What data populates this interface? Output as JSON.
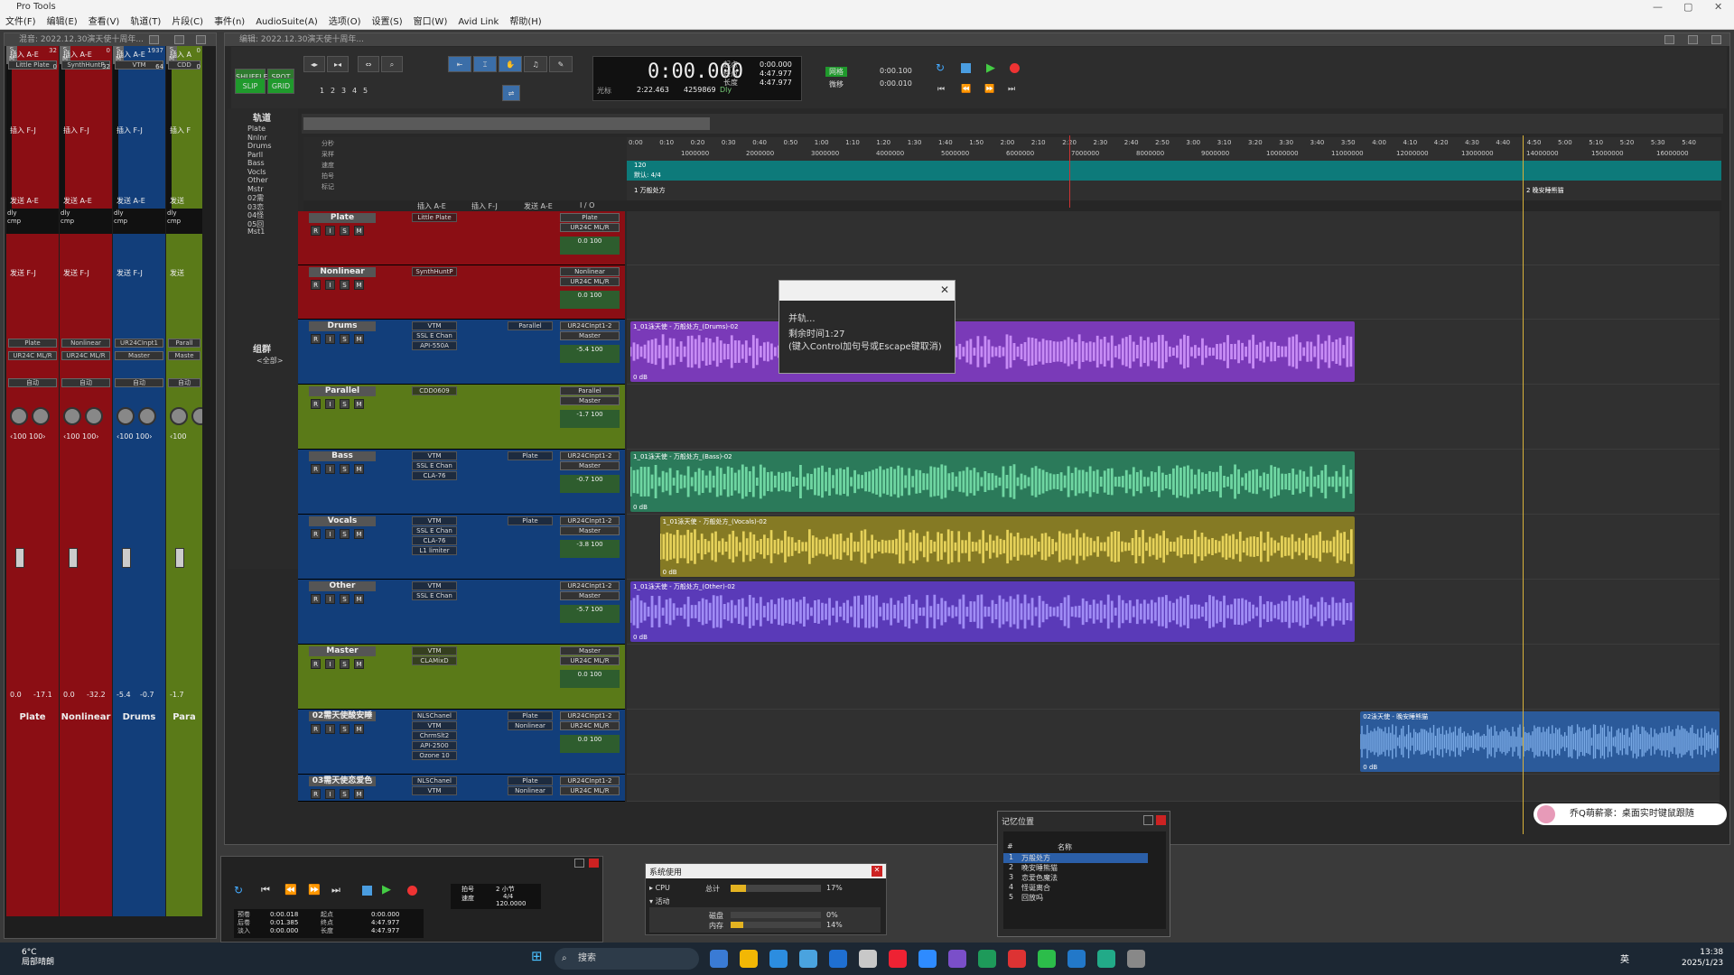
{
  "app": {
    "title": "Pro Tools"
  },
  "menu": [
    "文件(F)",
    "编辑(E)",
    "查看(V)",
    "轨道(T)",
    "片段(C)",
    "事件(n)",
    "AudioSuite(A)",
    "选项(O)",
    "设置(S)",
    "窗口(W)",
    "Avid Link",
    "帮助(H)"
  ],
  "mix_window": {
    "title": "混音: 2022.12.30演天使十周年...",
    "strips": [
      {
        "name": "Plate",
        "insert_ae": "插入 A-E",
        "insert_fj": "插入 F-J",
        "send_ae": "发送 A-E",
        "send_fj": "发送 F-J",
        "plugin": "Little Plate",
        "io_in": "Plate",
        "io_out": "UR24C ML/R",
        "auto": "自动",
        "pan": "‹100  100›",
        "vol": "0.0",
        "peak": "-17.1",
        "dly": "32",
        "cmp": "0",
        "color": "#8b0e14"
      },
      {
        "name": "Nonlinear",
        "insert_ae": "插入 A-E",
        "insert_fj": "插入 F-J",
        "send_ae": "发送 A-E",
        "send_fj": "发送 F-J",
        "plugin": "SynthHuntP",
        "io_in": "Nonlinear",
        "io_out": "UR24C ML/R",
        "auto": "自动",
        "pan": "‹100  100›",
        "vol": "0.0",
        "peak": "-32.2",
        "dly": "0",
        "cmp": "32",
        "color": "#8b0e14"
      },
      {
        "name": "Drums",
        "insert_ae": "插入 A-E",
        "insert_fj": "插入 F-J",
        "send_ae": "发送 A-E",
        "send_fj": "发送 F-J",
        "plugin": "VTM",
        "io_in": "UR24CInpt1",
        "io_out": "Master",
        "auto": "自动",
        "pan": "‹100  100›",
        "vol": "-5.4",
        "peak": "-0.7",
        "dly": "1937",
        "cmp": "64",
        "color": "#123e7a"
      },
      {
        "name": "Para",
        "insert_ae": "插入 A",
        "insert_fj": "插入 F",
        "send_ae": "发送",
        "send_fj": "发送",
        "plugin": "CDD",
        "io_in": "Parall",
        "io_out": "Maste",
        "auto": "自动",
        "pan": "‹100",
        "vol": "-1.7",
        "peak": "",
        "dly": "0",
        "cmp": "0",
        "color": "#5a7a18"
      }
    ]
  },
  "edit_window": {
    "title": "编辑: 2022.12.30演天使十周年...",
    "modes": [
      "SHUFFLE",
      "SPOT",
      "SLIP",
      "GRID"
    ],
    "nums": [
      "1",
      "2",
      "3",
      "4",
      "5"
    ],
    "counter": {
      "main": "0:00.000",
      "sub": "2:22.463",
      "samples": "4259869",
      "start": "0:00.000",
      "end": "4:47.977",
      "len": "4:47.977",
      "lbl_start": "起点",
      "lbl_end": "终点",
      "lbl_len": "长度",
      "cursor_lbl": "光标",
      "nudge": "0:00.100",
      "grid": "0:00.010",
      "nudge_lbl": "网格",
      "grid_lbl": "微移",
      "dly": "Dly"
    },
    "tracks_header": "轨道",
    "groups_header": "组群",
    "groups_all": "<全部>",
    "tracklist": [
      "Plate",
      "Nnlnr",
      "Drums",
      "Parll",
      "Bass",
      "Vocls",
      "Other",
      "Mstr",
      "02需",
      "03恋",
      "04怪",
      "05回",
      "Mst1"
    ],
    "ruler_times": [
      "0:00",
      "0:10",
      "0:20",
      "0:30",
      "0:40",
      "0:50",
      "1:00",
      "1:10",
      "1:20",
      "1:30",
      "1:40",
      "1:50",
      "2:00",
      "2:10",
      "2:20",
      "2:30",
      "2:40",
      "2:50",
      "3:00",
      "3:10",
      "3:20",
      "3:30",
      "3:40",
      "3:50",
      "4:00",
      "4:10",
      "4:20",
      "4:30",
      "4:40",
      "4:50",
      "5:00",
      "5:10",
      "5:20",
      "5:30",
      "5:40"
    ],
    "ruler_samples": [
      "1000000",
      "2000000",
      "3000000",
      "4000000",
      "5000000",
      "6000000",
      "7000000",
      "8000000",
      "9000000",
      "10000000",
      "11000000",
      "12000000",
      "13000000",
      "14000000",
      "15000000",
      "16000000"
    ],
    "ruler_rows": [
      "分秒",
      "采样",
      "速度",
      "拍号",
      "标记"
    ],
    "tempo": "120",
    "meter": "默认: 4/4",
    "markers": [
      "1 万般处方",
      "2 晚安睡熊猫"
    ],
    "col_headers": [
      "插入 A-E",
      "插入 F-J",
      "发送 A-E",
      "I / O"
    ],
    "tracks": [
      {
        "name": "Plate",
        "color": "#8b0e14",
        "h": 60,
        "ins": [
          "Little Plate"
        ],
        "io1": "Plate",
        "io2": "UR24C ML/R",
        "v1": "0.0",
        "v2": "100",
        "clip": null
      },
      {
        "name": "Nonlinear",
        "color": "#8b0e14",
        "h": 60,
        "ins": [
          "SynthHuntP"
        ],
        "io1": "Nonlinear",
        "io2": "UR24C ML/R",
        "v1": "0.0",
        "v2": "100",
        "clip": null
      },
      {
        "name": "Drums",
        "color": "#123e7a",
        "h": 72,
        "ins": [
          "VTM",
          "SSL E Chan",
          "API-550A"
        ],
        "send": "Parallel",
        "io1": "UR24CInpt1-2",
        "io2": "Master",
        "v1": "-5.4",
        "v2": "100",
        "clip": {
          "label": "1_01泳天使 - 万般处方_(Drums)-02",
          "db": "0 dB",
          "fill": "#7a3ab8",
          "wave": "#c78cf5",
          "x0": 0.0,
          "x1": 0.666
        }
      },
      {
        "name": "Parallel",
        "color": "#5a7a18",
        "h": 72,
        "ins": [
          "CDD0609"
        ],
        "send": "",
        "io1": "Parallel",
        "io2": "Master",
        "v1": "-1.7",
        "v2": "100",
        "clip": null
      },
      {
        "name": "Bass",
        "color": "#123e7a",
        "h": 72,
        "ins": [
          "VTM",
          "SSL E Chan",
          "CLA-76"
        ],
        "send": "Plate",
        "io1": "UR24CInpt1-2",
        "io2": "Master",
        "v1": "-0.7",
        "v2": "100",
        "clip": {
          "label": "1_01泳天使 - 万般处方_(Bass)-02",
          "db": "0 dB",
          "fill": "#2b7a5a",
          "wave": "#6fd6a2",
          "x0": 0.0,
          "x1": 0.666
        }
      },
      {
        "name": "Vocals",
        "color": "#123e7a",
        "h": 72,
        "ins": [
          "VTM",
          "SSL E Chan",
          "CLA-76",
          "L1 limiter"
        ],
        "send": "Plate",
        "io1": "UR24CInpt1-2",
        "io2": "Master",
        "v1": "-3.8",
        "v2": "100",
        "clip": {
          "label": "1_01泳天使 - 万般处方_(Vocals)-02",
          "db": "0 dB",
          "fill": "#857a24",
          "wave": "#e6d25a",
          "x0": 0.027,
          "x1": 0.666
        }
      },
      {
        "name": "Other",
        "color": "#123e7a",
        "h": 72,
        "ins": [
          "VTM",
          "SSL E Chan"
        ],
        "send": "",
        "io1": "UR24CInpt1-2",
        "io2": "Master",
        "v1": "-5.7",
        "v2": "100",
        "clip": {
          "label": "1_01泳天使 - 万般处方_(Other)-02",
          "db": "0 dB",
          "fill": "#5a3ab8",
          "wave": "#a08cf5",
          "x0": 0.0,
          "x1": 0.666
        }
      },
      {
        "name": "Master",
        "color": "#5a7a18",
        "h": 72,
        "ins": [
          "VTM",
          "CLAMixD"
        ],
        "send": "",
        "io1": "Master",
        "io2": "UR24C ML/R",
        "v1": "0.0",
        "v2": "100",
        "clip": null
      },
      {
        "name": "02需天使酸安睡",
        "color": "#123e7a",
        "h": 72,
        "ins": [
          "NLSChanel",
          "VTM",
          "ChrmSlt2",
          "API-2500",
          "Ozone 10"
        ],
        "send": "Plate",
        "send2": "Nonlinear",
        "io1": "UR24CInpt1-2",
        "io2": "UR24C ML/R",
        "v1": "0.0",
        "v2": "100",
        "clip": {
          "label": "02泳天使 - 晚安睡熊猫",
          "db": "0 dB",
          "fill": "#2b5a9a",
          "wave": "#7aaae6",
          "x0": 0.668,
          "x1": 1.0
        }
      },
      {
        "name": "03需天使恋爱色",
        "color": "#123e7a",
        "h": 30,
        "ins": [
          "NLSChanel",
          "VTM"
        ],
        "send": "Plate",
        "send2": "Nonlinear",
        "io1": "UR24CInpt1-2",
        "io2": "UR24C ML/R",
        "v1": "",
        "v2": "",
        "clip": null
      }
    ]
  },
  "dialog": {
    "line1": "并轨...",
    "line2": "剩余时间1:27",
    "line3": "(键入Control加句号或Escape键取消)"
  },
  "transport": {
    "pre": "预卷",
    "post": "后卷",
    "fade": "淡入",
    "pre_v": "0:00.018",
    "post_v": "0:01.385",
    "fade_v": "0:00.000",
    "s_lbl": "起点",
    "e_lbl": "终点",
    "l_lbl": "长度",
    "s_v": "0:00.000",
    "e_v": "4:47.977",
    "l_v": "4:47.977",
    "tempo": "120.0000",
    "meter": "4/4",
    "click": "拍号",
    "key": "速度",
    "bars": "2 小节"
  },
  "sysuse": {
    "title": "系统使用",
    "cpu_lbl": "CPU",
    "cpu_total": "总计",
    "cpu_pct": 0.17,
    "cpu_txt": "17%",
    "act_lbl": "活动",
    "disk_lbl": "磁盘",
    "disk_txt": "0%",
    "disk_pct": 0.0,
    "mem_lbl": "内存",
    "mem_txt": "14%",
    "mem_pct": 0.14
  },
  "memory": {
    "title": "记忆位置",
    "col_num": "#",
    "col_name": "名称",
    "rows": [
      {
        "n": "1",
        "name": "万般处方"
      },
      {
        "n": "2",
        "name": "晚安睡熊猫"
      },
      {
        "n": "3",
        "name": "恋爱色魔法"
      },
      {
        "n": "4",
        "name": "怪诞离合"
      },
      {
        "n": "5",
        "name": "回放吗"
      }
    ]
  },
  "toast": {
    "text": "乔Q萌薪豪：桌面实时键鼠跟随"
  },
  "taskbar": {
    "weather_temp": "6°C",
    "weather_txt": "局部晴朗",
    "search": "搜索",
    "time": "13:38",
    "date": "2025/1/23",
    "ime": "英"
  }
}
